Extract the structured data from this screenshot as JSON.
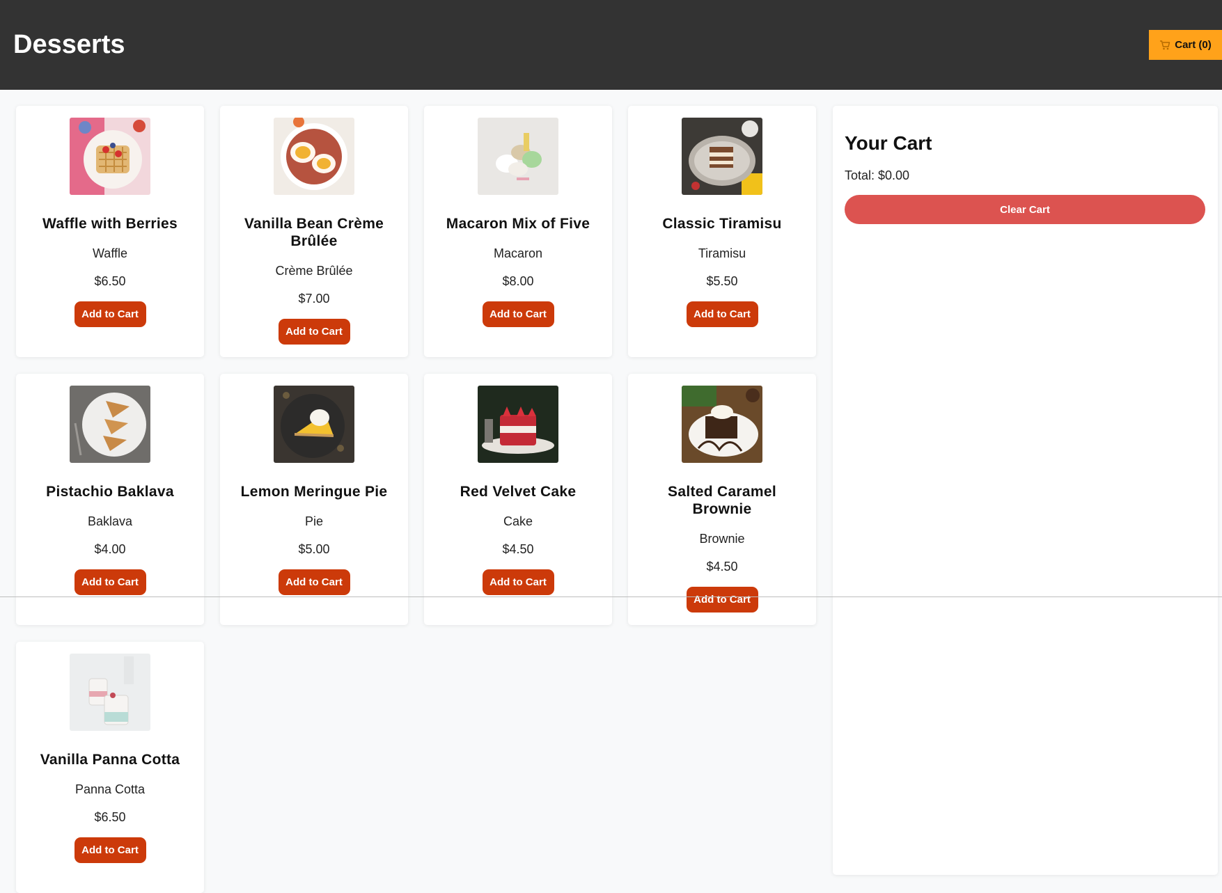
{
  "header": {
    "title": "Desserts",
    "cart_label": "Cart (0)",
    "cart_icon": "shopping-cart-icon",
    "background": "#333333",
    "cart_button_color": "#ffa21a"
  },
  "products": [
    {
      "name": "Waffle with Berries",
      "category": "Waffle",
      "price": "$6.50",
      "button": "Add to Cart",
      "image": "waffle-photo"
    },
    {
      "name": "Vanilla Bean Crème Brûlée",
      "category": "Crème Brûlée",
      "price": "$7.00",
      "button": "Add to Cart",
      "image": "creme-brulee-photo"
    },
    {
      "name": "Macaron Mix of Five",
      "category": "Macaron",
      "price": "$8.00",
      "button": "Add to Cart",
      "image": "macaron-photo"
    },
    {
      "name": "Classic Tiramisu",
      "category": "Tiramisu",
      "price": "$5.50",
      "button": "Add to Cart",
      "image": "tiramisu-photo"
    },
    {
      "name": "Pistachio Baklava",
      "category": "Baklava",
      "price": "$4.00",
      "button": "Add to Cart",
      "image": "baklava-photo"
    },
    {
      "name": "Lemon Meringue Pie",
      "category": "Pie",
      "price": "$5.00",
      "button": "Add to Cart",
      "image": "lemon-pie-photo"
    },
    {
      "name": "Red Velvet Cake",
      "category": "Cake",
      "price": "$4.50",
      "button": "Add to Cart",
      "image": "red-velvet-photo"
    },
    {
      "name": "Salted Caramel Brownie",
      "category": "Brownie",
      "price": "$4.50",
      "button": "Add to Cart",
      "image": "brownie-photo"
    },
    {
      "name": "Vanilla Panna Cotta",
      "category": "Panna Cotta",
      "price": "$6.50",
      "button": "Add to Cart",
      "image": "panna-cotta-photo"
    }
  ],
  "cart": {
    "title": "Your Cart",
    "total": "Total: $0.00",
    "clear_label": "Clear Cart",
    "clear_color": "#dc5350"
  },
  "colors": {
    "add_button": "#cc3a0a",
    "page_bg": "#f8f9fa"
  }
}
